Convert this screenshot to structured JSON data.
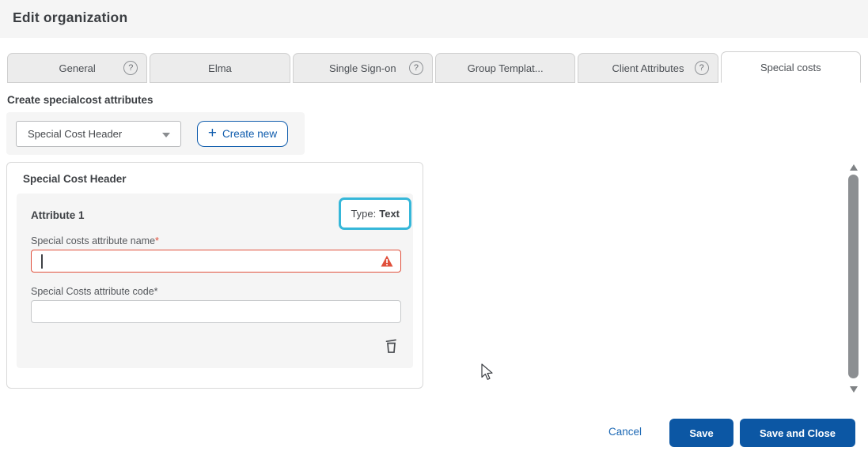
{
  "header": {
    "title": "Edit organization"
  },
  "tabs": [
    {
      "label": "General",
      "has_help": true,
      "active": false
    },
    {
      "label": "Elma",
      "has_help": false,
      "active": false
    },
    {
      "label": "Single Sign-on",
      "has_help": true,
      "active": false
    },
    {
      "label": "Group Templat...",
      "has_help": false,
      "active": false
    },
    {
      "label": "Client Attributes",
      "has_help": true,
      "active": false
    },
    {
      "label": "Special costs",
      "has_help": false,
      "active": true
    }
  ],
  "help_icon_glyph": "?",
  "section": {
    "heading": "Create specialcost attributes"
  },
  "toolbar": {
    "dropdown_value": "Special Cost Header",
    "plus_icon": "+",
    "create_new_label": "Create new"
  },
  "card": {
    "title": "Special Cost Header",
    "attribute": {
      "name": "Attribute 1",
      "type_label": "Type:",
      "type_value": "Text",
      "fields": [
        {
          "label": "Special costs attribute name",
          "required_mark": "*",
          "value": "",
          "error": true
        },
        {
          "label": "Special Costs attribute code",
          "required_mark": "*",
          "value": "",
          "error": false
        }
      ],
      "delete_icon": "trash-icon"
    }
  },
  "footer": {
    "cancel_label": "Cancel",
    "save_label": "Save",
    "save_and_close_label": "Save and Close"
  },
  "colors": {
    "primary_blue": "#0c57a4",
    "link_blue": "#1d69b5",
    "create_blue": "#0f5cad",
    "error_red": "#e0503c",
    "highlight_teal": "#36b7d9",
    "header_bg": "#f5f5f5",
    "tab_bg": "#ececec"
  }
}
